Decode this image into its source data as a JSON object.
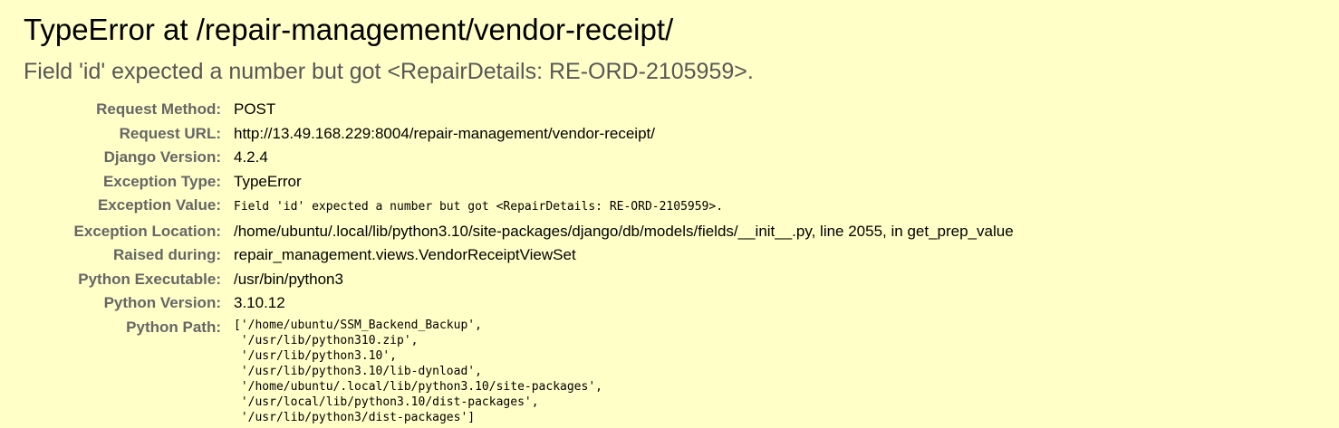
{
  "title": "TypeError at /repair-management/vendor-receipt/",
  "exception_value": "Field 'id' expected a number but got <RepairDetails: RE-ORD-2105959>.",
  "meta": {
    "request_method": {
      "label": "Request Method:",
      "value": "POST"
    },
    "request_url": {
      "label": "Request URL:",
      "value": "http://13.49.168.229:8004/repair-management/vendor-receipt/"
    },
    "django_version": {
      "label": "Django Version:",
      "value": "4.2.4"
    },
    "exception_type": {
      "label": "Exception Type:",
      "value": "TypeError"
    },
    "exception_value": {
      "label": "Exception Value:",
      "value": "Field 'id' expected a number but got <RepairDetails: RE-ORD-2105959>."
    },
    "exception_location": {
      "label": "Exception Location:",
      "value": "/home/ubuntu/.local/lib/python3.10/site-packages/django/db/models/fields/__init__.py, line 2055, in get_prep_value"
    },
    "raised_during": {
      "label": "Raised during:",
      "value": "repair_management.views.VendorReceiptViewSet"
    },
    "python_executable": {
      "label": "Python Executable:",
      "value": "/usr/bin/python3"
    },
    "python_version": {
      "label": "Python Version:",
      "value": "3.10.12"
    },
    "python_path": {
      "label": "Python Path:",
      "value": "['/home/ubuntu/SSM_Backend_Backup',\n '/usr/lib/python310.zip',\n '/usr/lib/python3.10',\n '/usr/lib/python3.10/lib-dynload',\n '/home/ubuntu/.local/lib/python3.10/site-packages',\n '/usr/local/lib/python3.10/dist-packages',\n '/usr/lib/python3/dist-packages']"
    }
  }
}
